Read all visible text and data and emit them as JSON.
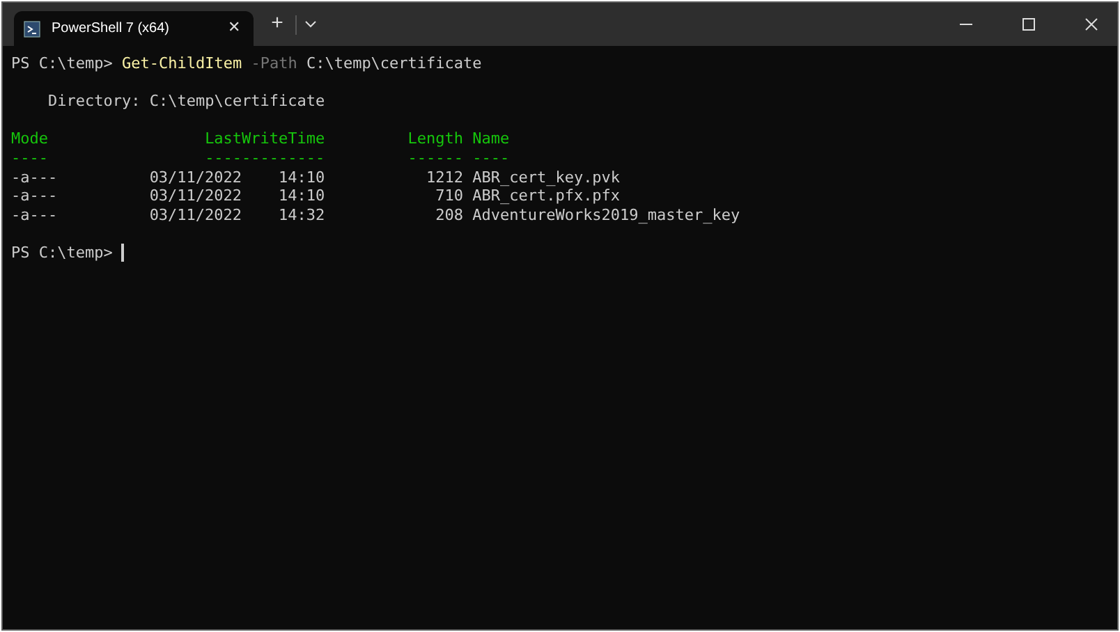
{
  "tab": {
    "title": "PowerShell 7 (x64)",
    "close": "✕"
  },
  "new_tab": "+",
  "terminal": {
    "command": {
      "prompt": "PS C:\\temp> ",
      "cmdlet": "Get-ChildItem",
      "parameter": "-Path",
      "argument": "C:\\temp\\certificate"
    },
    "directory": "    Directory: C:\\temp\\certificate",
    "headers": [
      "Mode",
      "LastWriteTime",
      "Length",
      "Name"
    ],
    "underlines": [
      "----",
      "-------------",
      "------",
      "----"
    ],
    "rows": [
      {
        "mode": "-a---",
        "last_write_time": "03/11/2022    14:10",
        "length": "1212",
        "name": "ABR_cert_key.pvk"
      },
      {
        "mode": "-a---",
        "last_write_time": "03/11/2022    14:10",
        "length": "710",
        "name": "ABR_cert.pfx.pfx"
      },
      {
        "mode": "-a---",
        "last_write_time": "03/11/2022    14:32",
        "length": "208",
        "name": "AdventureWorks2019_master_key"
      }
    ],
    "prompt": "PS C:\\temp> "
  }
}
